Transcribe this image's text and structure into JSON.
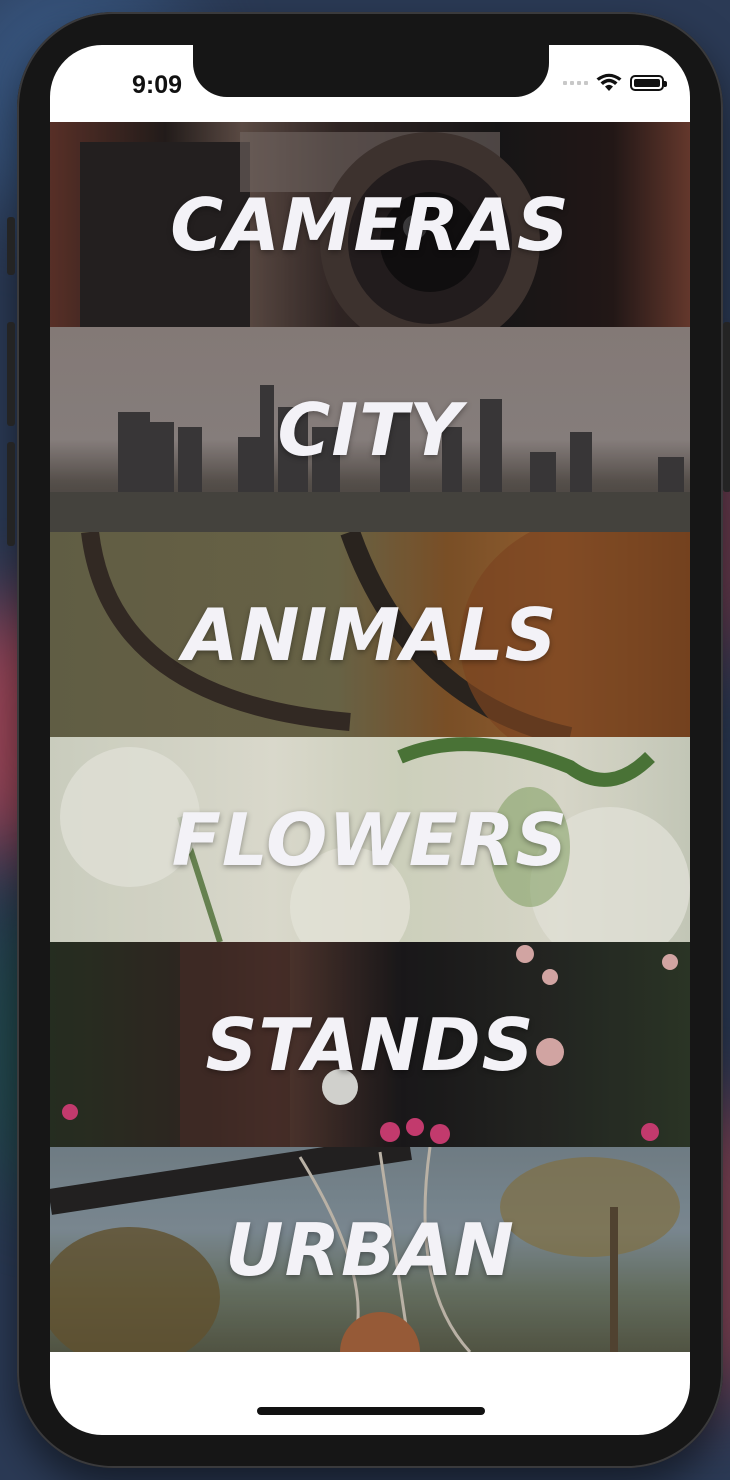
{
  "status_bar": {
    "time": "9:09"
  },
  "categories": [
    {
      "label": "CAMERAS"
    },
    {
      "label": "CITY"
    },
    {
      "label": "ANIMALS"
    },
    {
      "label": "FLOWERS"
    },
    {
      "label": "STANDS"
    },
    {
      "label": "URBAN"
    }
  ],
  "icons": [
    "cellular-signal-icon",
    "wifi-icon",
    "battery-icon"
  ],
  "colors": {
    "label_text": "#f3f2f7",
    "frame": "#161616",
    "screen": "#ffffff"
  }
}
